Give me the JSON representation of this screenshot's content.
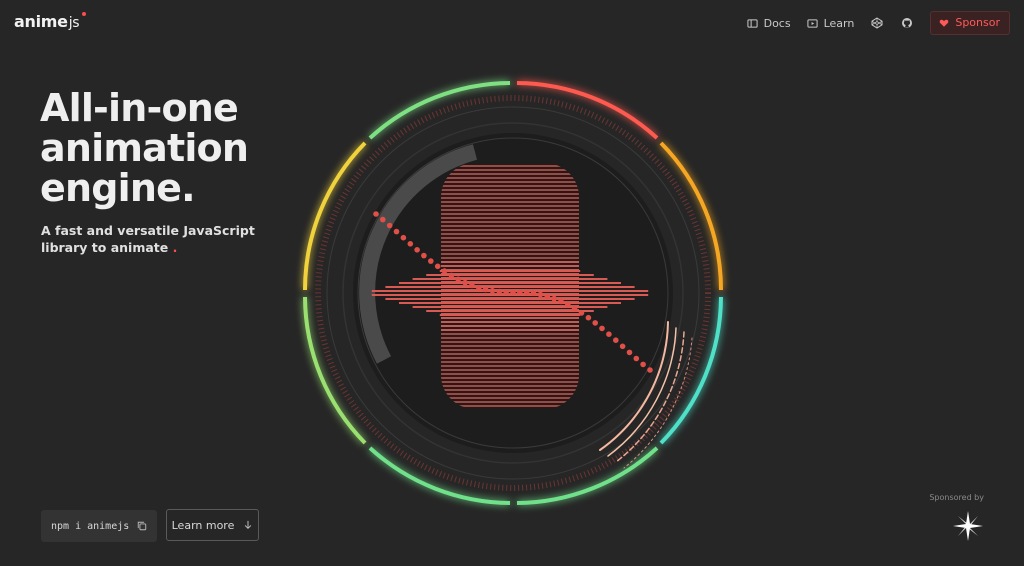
{
  "brand": {
    "name": "anime",
    "suffix": "js"
  },
  "nav": {
    "docs": "Docs",
    "learn": "Learn",
    "codepen_icon": "codepen-icon",
    "github_icon": "github-icon",
    "sponsor": "Sponsor"
  },
  "hero": {
    "title_line1": "All-in-one",
    "title_line2": "animation",
    "title_line3": "engine.",
    "subtitle": "A fast and versatile JavaScript library to animate",
    "subtitle_dot": "."
  },
  "install": {
    "command": "npm i animejs",
    "copy_icon": "copy-icon"
  },
  "learn_more": {
    "label": "Learn more",
    "icon": "arrow-down-icon"
  },
  "sponsor_section": {
    "label": "Sponsored by",
    "logo_icon": "star-logo-icon"
  },
  "colors": {
    "background": "#262626",
    "accent_red": "#ff4b4b",
    "ring_orange": "#f5a623",
    "ring_yellow": "#f0d23c",
    "ring_green": "#6fe08a",
    "ring_teal": "#4fe0c8"
  }
}
